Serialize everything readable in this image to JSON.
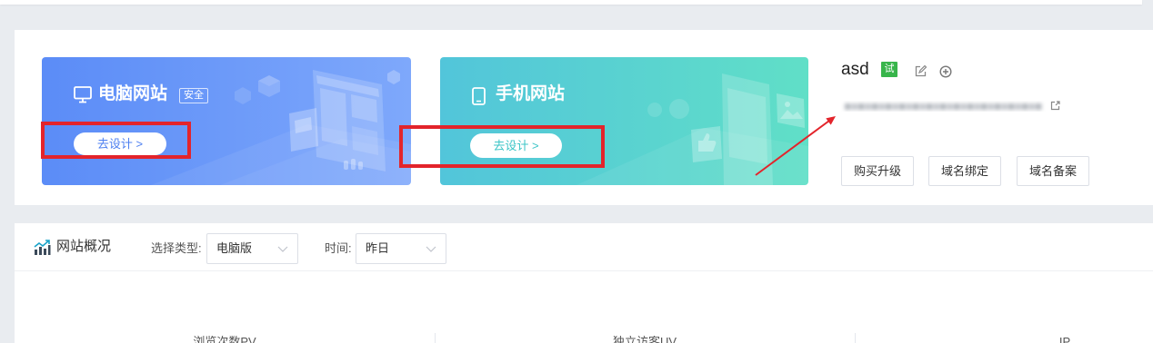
{
  "theme": {
    "page_background": "#e9ecf0",
    "pc_card_gradient": [
      "#5b8cf7",
      "#7ea8fb"
    ],
    "mobile_card_gradient": [
      "#52c5da",
      "#60dfc7"
    ],
    "pc_button_text": "#4d7ff0",
    "mobile_button_text": "#3cc5c7",
    "trial_badge": "#38b54b",
    "annotation_red": "#e3242b"
  },
  "site_cards": {
    "pc": {
      "icon": "monitor-icon",
      "title": "电脑网站",
      "badge": "安全",
      "button_label": "去设计 >"
    },
    "mobile": {
      "icon": "mobile-phone-icon",
      "title": "手机网站",
      "button_label": "去设计 >"
    }
  },
  "site_info": {
    "name": "asd",
    "trial_badge": "试",
    "edit_icon": "edit-icon",
    "add_icon": "plus-circle-icon",
    "domain_link_icon": "external-link-icon",
    "buttons": {
      "upgrade": "购买升级",
      "bind_domain": "域名绑定",
      "domain_filing": "域名备案"
    }
  },
  "overview": {
    "icon": "trend-chart-icon",
    "title": "网站概况",
    "select_icon": "chevron-down-icon",
    "type_filter": {
      "label": "选择类型:",
      "value": "电脑版"
    },
    "time_filter": {
      "label": "时间:",
      "value": "昨日"
    },
    "stats": [
      {
        "label": "浏览次数PV"
      },
      {
        "label": "独立访客UV"
      },
      {
        "label": "IP"
      }
    ]
  }
}
